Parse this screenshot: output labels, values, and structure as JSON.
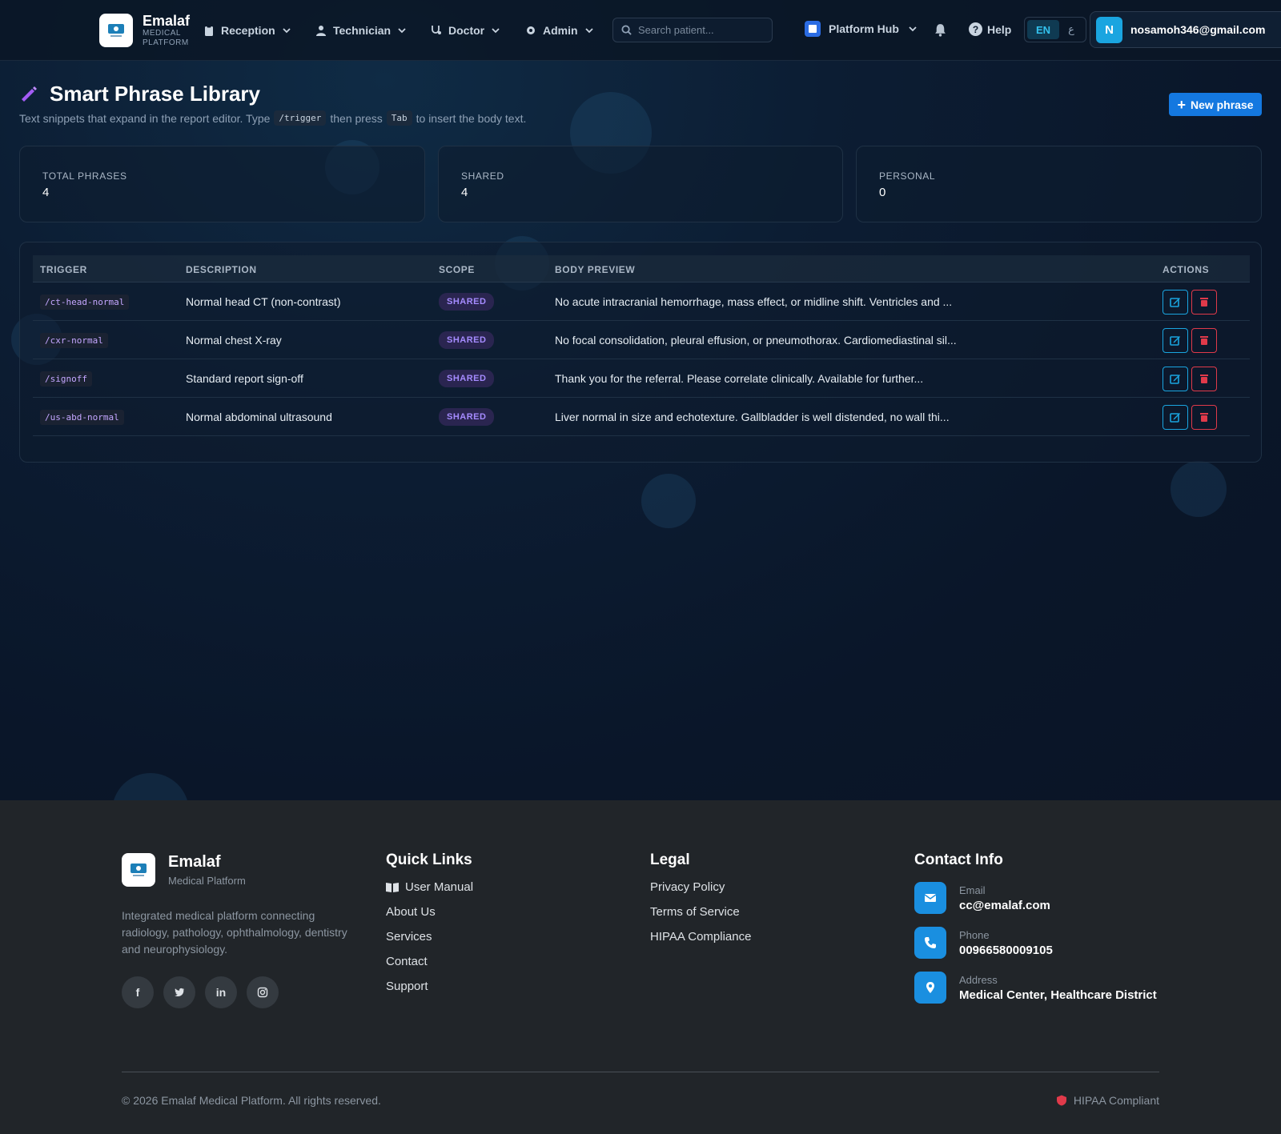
{
  "brand": {
    "name": "Emalaf",
    "sub": "MEDICAL PLATFORM"
  },
  "nav": {
    "items": [
      {
        "label": "Reception",
        "icon": "clipboard-icon"
      },
      {
        "label": "Technician",
        "icon": "user-icon"
      },
      {
        "label": "Doctor",
        "icon": "stethoscope-icon"
      },
      {
        "label": "Admin",
        "icon": "gear-icon"
      }
    ],
    "search_placeholder": "Search patient...",
    "hub_label": "Platform Hub",
    "help_label": "Help",
    "lang_en": "EN",
    "lang_ar": "ع",
    "user_initial": "N",
    "user_email": "nosamoh346@gmail.com"
  },
  "header": {
    "title": "Smart Phrase Library",
    "subtitle_1": "Text snippets that expand in the report editor. Type",
    "subtitle_code1": "/trigger",
    "subtitle_2": "then press",
    "subtitle_code2": "Tab",
    "subtitle_3": "to insert the body text.",
    "new_button": "New phrase"
  },
  "stats": [
    {
      "label": "TOTAL PHRASES",
      "value": "4"
    },
    {
      "label": "SHARED",
      "value": "4"
    },
    {
      "label": "PERSONAL",
      "value": "0"
    }
  ],
  "table": {
    "headers": [
      "TRIGGER",
      "DESCRIPTION",
      "SCOPE",
      "BODY PREVIEW",
      "ACTIONS"
    ],
    "rows": [
      {
        "trigger": "/ct-head-normal",
        "description": "Normal head CT (non-contrast)",
        "scope": "SHARED",
        "preview": "No acute intracranial hemorrhage, mass effect, or midline shift. Ventricles and ..."
      },
      {
        "trigger": "/cxr-normal",
        "description": "Normal chest X-ray",
        "scope": "SHARED",
        "preview": "No focal consolidation, pleural effusion, or pneumothorax. Cardiomediastinal sil..."
      },
      {
        "trigger": "/signoff",
        "description": "Standard report sign-off",
        "scope": "SHARED",
        "preview": "Thank you for the referral. Please correlate clinically. Available for further..."
      },
      {
        "trigger": "/us-abd-normal",
        "description": "Normal abdominal ultrasound",
        "scope": "SHARED",
        "preview": "Liver normal in size and echotexture. Gallbladder is well distended, no wall thi..."
      }
    ]
  },
  "footer": {
    "brand_name": "Emalaf",
    "brand_sub": "Medical Platform",
    "about": "Integrated medical platform connecting radiology, pathology, ophthalmology, dentistry and neurophysiology.",
    "quick_links_title": "Quick Links",
    "quick_links": [
      "User Manual",
      "About Us",
      "Services",
      "Contact",
      "Support"
    ],
    "legal_title": "Legal",
    "legal_links": [
      "Privacy Policy",
      "Terms of Service",
      "HIPAA Compliance"
    ],
    "contact_title": "Contact Info",
    "contact": [
      {
        "label": "Email",
        "value": "cc@emalaf.com"
      },
      {
        "label": "Phone",
        "value": "00966580009105"
      },
      {
        "label": "Address",
        "value": "Medical Center, Healthcare District"
      }
    ],
    "copyright": "© 2026 Emalaf Medical Platform. All rights reserved.",
    "hipaa": "HIPAA Compliant"
  },
  "colors": {
    "accent": "#1478e0",
    "danger": "#e03a4a",
    "info": "#1aa5e0",
    "badge": "#a58bff"
  }
}
